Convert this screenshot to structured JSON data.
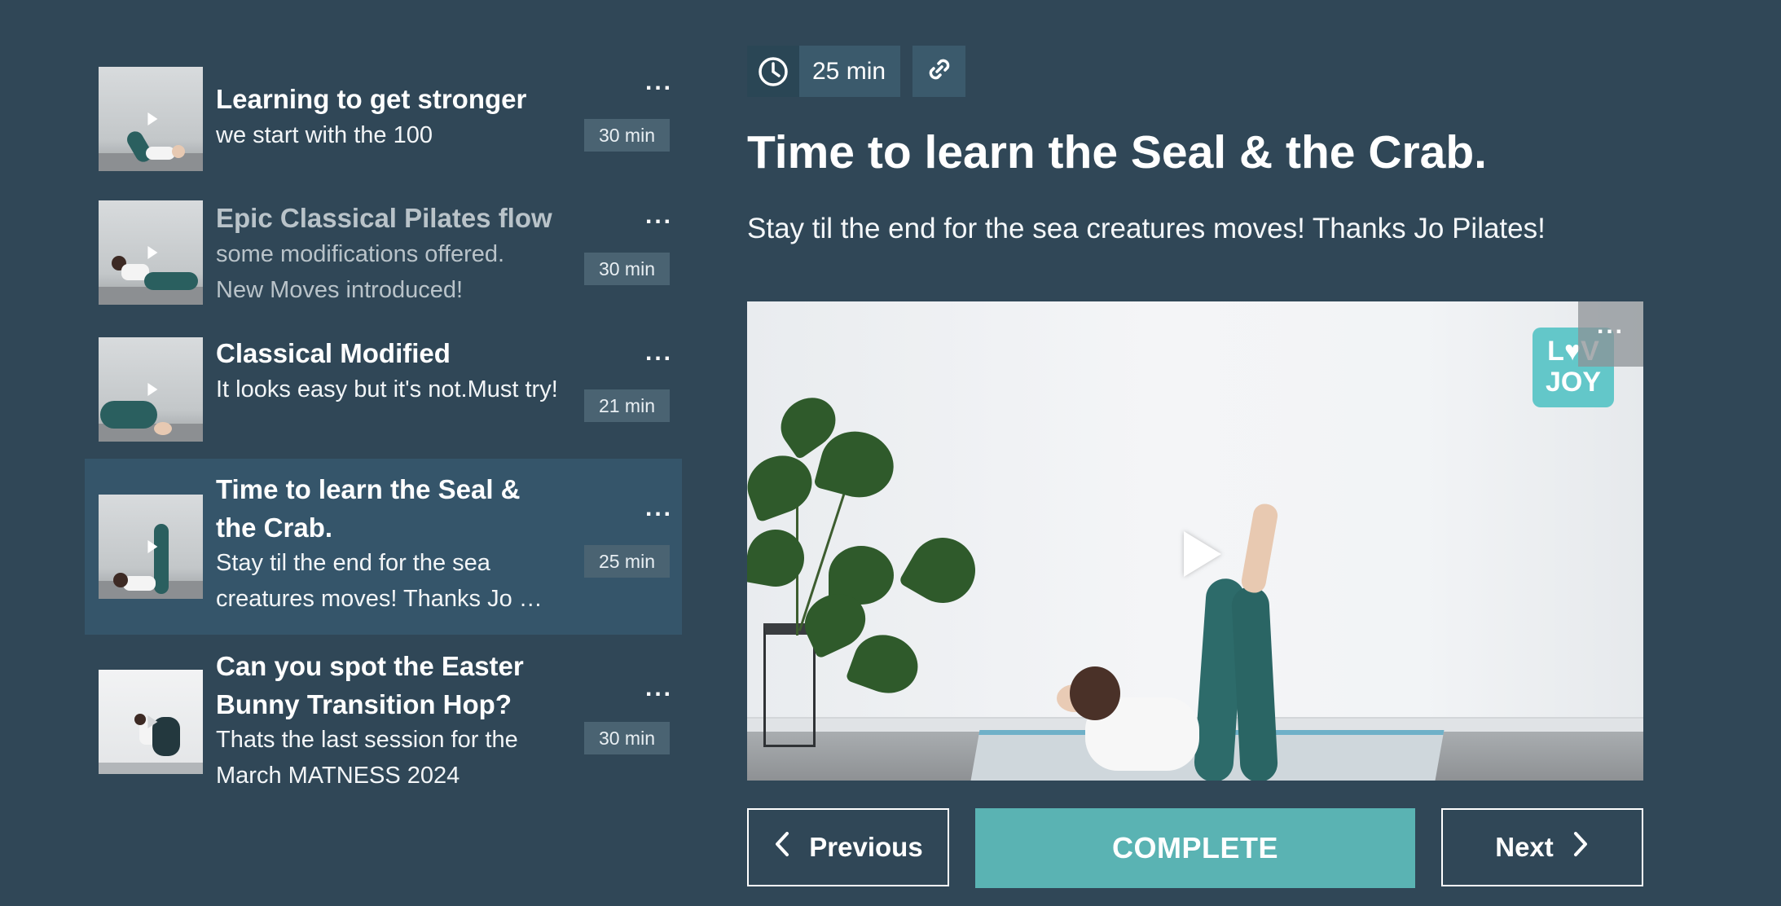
{
  "playlist": {
    "items": [
      {
        "title": "Learning to get stronger",
        "description": "we start with the 100",
        "duration": "30 min",
        "menu": "..."
      },
      {
        "title": "Epic Classical Pilates flow",
        "description": "some modifications offered. New Moves introduced!",
        "duration": "30 min",
        "menu": "..."
      },
      {
        "title": "Classical Modified",
        "description": "It looks easy but it's not.Must try!",
        "duration": "21 min",
        "menu": "..."
      },
      {
        "title": "Time to learn the Seal & the Crab.",
        "description": "Stay til the end for the sea creatures moves! Thanks Jo …",
        "duration": "25 min",
        "menu": "...",
        "active": true
      },
      {
        "title": "Can you spot the Easter Bunny Transition Hop?",
        "description": "Thats the last session for the March MATNESS 2024",
        "duration": "30 min",
        "menu": "..."
      }
    ]
  },
  "header": {
    "duration": "25 min",
    "clock_icon": "clock-icon",
    "link_icon": "link-icon"
  },
  "main": {
    "title": "Time to learn the Seal & the Crab.",
    "description": "Stay til the end for the sea creatures moves! Thanks Jo Pilates!"
  },
  "video": {
    "logo_line1": "L♥V",
    "logo_line2": "JOY",
    "menu": "..."
  },
  "buttons": {
    "previous": "Previous",
    "complete": "COMPLETE",
    "next": "Next"
  },
  "colors": {
    "background": "#304757",
    "active_row": "#35556a",
    "accent": "#5ab3b3"
  }
}
